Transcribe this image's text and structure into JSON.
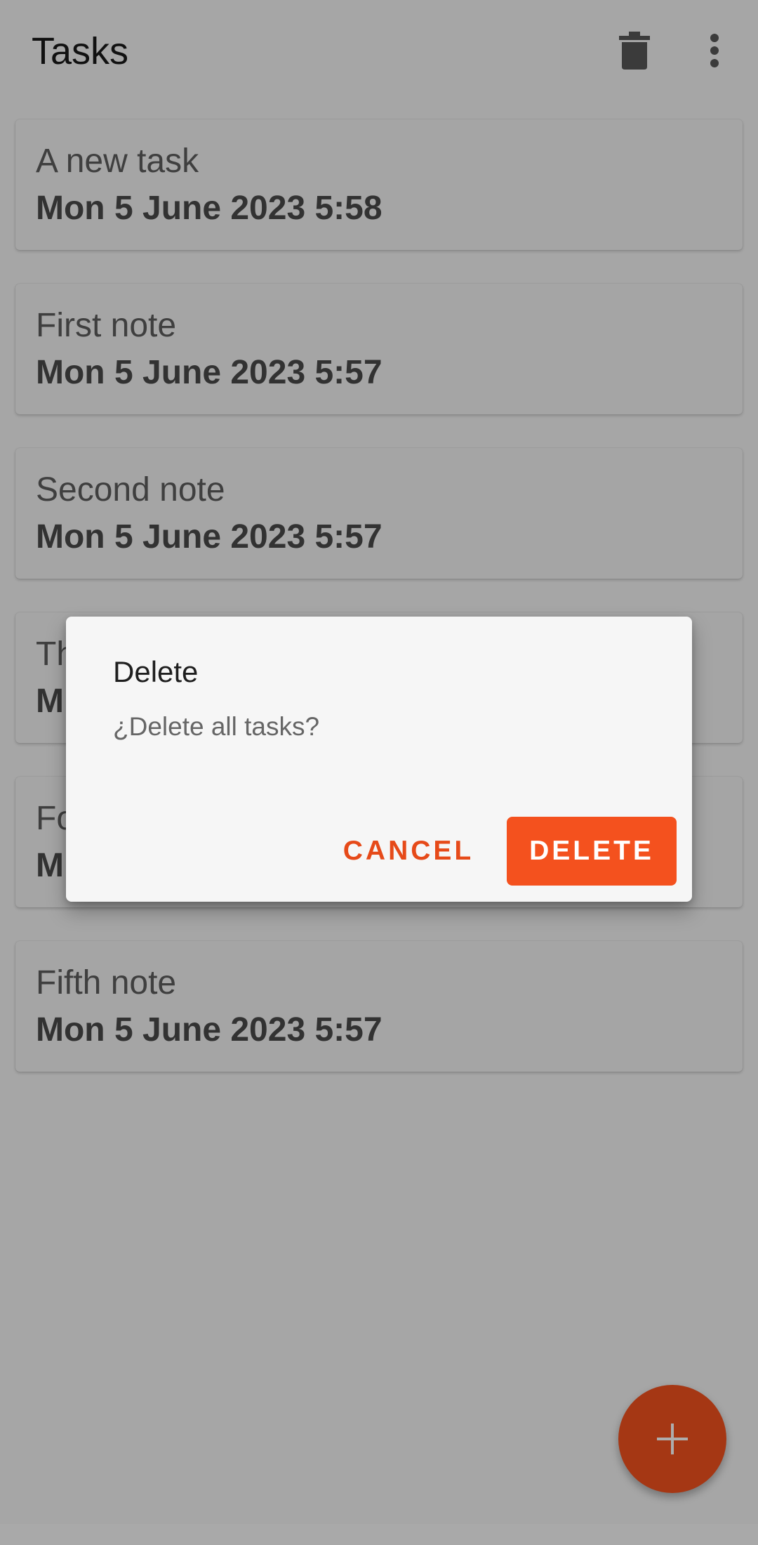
{
  "app": {
    "title": "Tasks",
    "accent_color": "#f4511e"
  },
  "toolbar": {
    "delete_all_icon": "trash-icon",
    "overflow_icon": "more-vert-icon"
  },
  "tasks": [
    {
      "title": "A new task",
      "date": "Mon 5 June 2023 5:58"
    },
    {
      "title": "First note",
      "date": "Mon 5 June 2023 5:57"
    },
    {
      "title": "Second note",
      "date": "Mon 5 June 2023 5:57"
    },
    {
      "title": "Th",
      "date": "M"
    },
    {
      "title": "Fo",
      "date": "M"
    },
    {
      "title": "Fifth note",
      "date": "Mon 5 June 2023 5:57"
    }
  ],
  "fab": {
    "icon": "plus-icon"
  },
  "dialog": {
    "title": "Delete",
    "message": "¿Delete all tasks?",
    "cancel_label": "CANCEL",
    "confirm_label": "DELETE"
  }
}
